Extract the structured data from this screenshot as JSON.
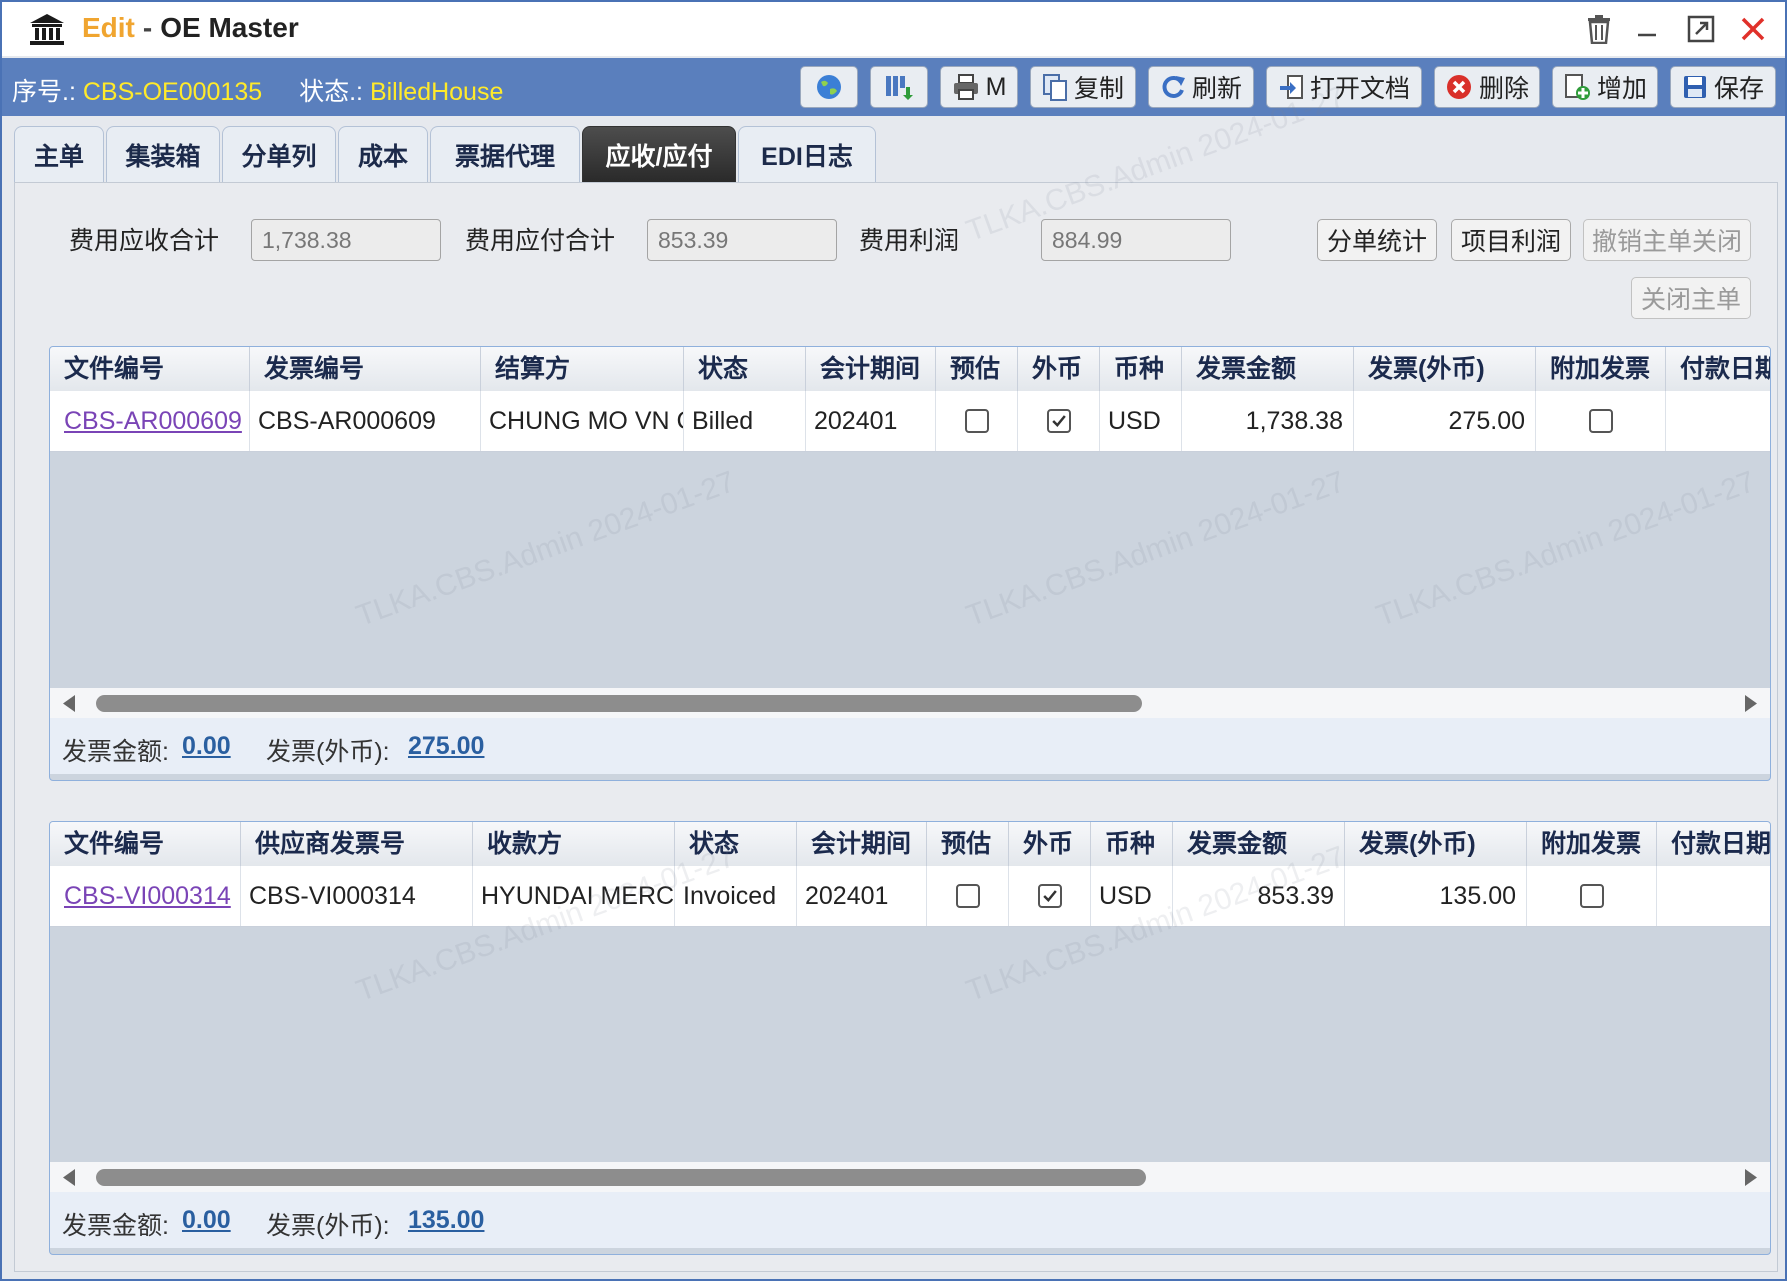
{
  "window": {
    "mode": "Edit",
    "separator": "-",
    "title": "OE Master"
  },
  "info": {
    "serial_label": "序号.:",
    "serial_value": "CBS-OE000135",
    "status_label": "状态.:",
    "status_value": "BilledHouse"
  },
  "toolbar": {
    "print_label": "M",
    "copy_label": "复制",
    "refresh_label": "刷新",
    "open_doc_label": "打开文档",
    "delete_label": "删除",
    "add_label": "增加",
    "save_label": "保存"
  },
  "tabs": [
    {
      "label": "主单",
      "active": false
    },
    {
      "label": "集装箱",
      "active": false
    },
    {
      "label": "分单列",
      "active": false
    },
    {
      "label": "成本",
      "active": false
    },
    {
      "label": "票据代理",
      "active": false
    },
    {
      "label": "应收/应付",
      "active": true
    },
    {
      "label": "EDI日志",
      "active": false
    }
  ],
  "summary": {
    "receivable_label": "费用应收合计",
    "receivable_value": "1,738.38",
    "payable_label": "费用应付合计",
    "payable_value": "853.39",
    "profit_label": "费用利润",
    "profit_value": "884.99",
    "house_stats_label": "分单统计",
    "project_profit_label": "项目利润",
    "cancel_close_label": "撤销主单关闭",
    "close_master_label": "关闭主单"
  },
  "ar_grid": {
    "headers": [
      "文件编号",
      "发票编号",
      "结算方",
      "状态",
      "会计期间",
      "预估",
      "外币",
      "币种",
      "发票金额",
      "发票(外币)",
      "附加发票",
      "付款日期"
    ],
    "row": {
      "file_no": "CBS-AR000609",
      "invoice_no": "CBS-AR000609",
      "party": "CHUNG MO VN CO",
      "status": "Billed",
      "period": "202401",
      "estimate": false,
      "foreign": true,
      "currency": "USD",
      "amount": "1,738.38",
      "amount_foreign": "275.00",
      "extra_invoice": false,
      "pay_date": ""
    },
    "footer": {
      "amount_label": "发票金额:",
      "amount_value": "0.00",
      "foreign_label": "发票(外币):",
      "foreign_value": "275.00"
    }
  },
  "ap_grid": {
    "headers": [
      "文件编号",
      "供应商发票号",
      "收款方",
      "状态",
      "会计期间",
      "预估",
      "外币",
      "币种",
      "发票金额",
      "发票(外币)",
      "附加发票",
      "付款日期"
    ],
    "row": {
      "file_no": "CBS-VI000314",
      "invoice_no": "CBS-VI000314",
      "party": "HYUNDAI MERCHANT",
      "status": "Invoiced",
      "period": "202401",
      "estimate": false,
      "foreign": true,
      "currency": "USD",
      "amount": "853.39",
      "amount_foreign": "135.00",
      "extra_invoice": false,
      "pay_date": ""
    },
    "footer": {
      "amount_label": "发票金额:",
      "amount_value": "0.00",
      "foreign_label": "发票(外币):",
      "foreign_value": "135.00"
    }
  },
  "watermark": "TLKA.CBS.Admin 2024-01-27",
  "colors": {
    "title_mode": "#f0a530",
    "info_value": "#ffea2a",
    "info_bar": "#5a7fbd",
    "link": "#7a44b6",
    "footer_value": "#2a5fa0"
  }
}
